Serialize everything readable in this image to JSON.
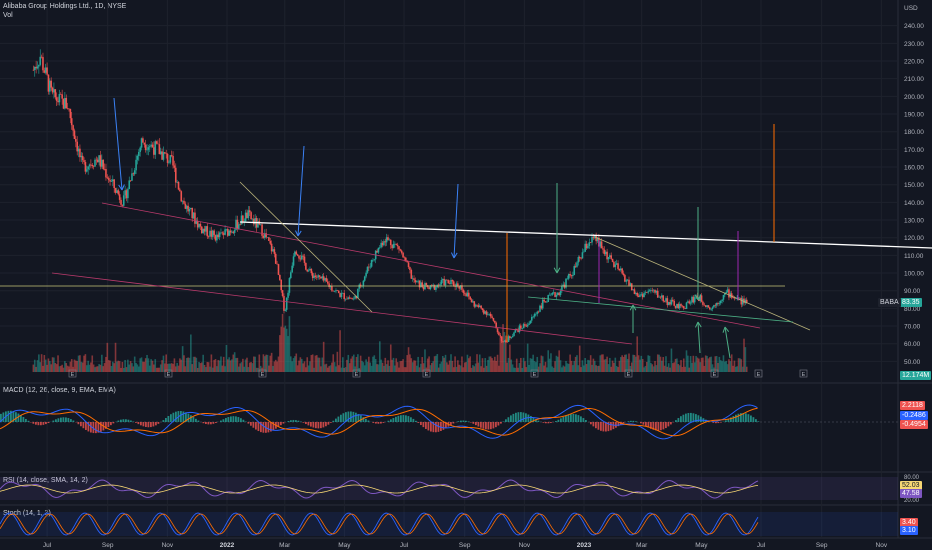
{
  "header": {
    "symbol_line": "Alibaba Group Holdings Ltd., 1D, NYSE",
    "vol_label": "Vol"
  },
  "indicators": {
    "macd": "MACD (12, 26, close, 9, EMA, EMA)",
    "rsi": "RSI (14, close, SMA, 14, 2)",
    "stoch": "Stoch (14, 1, 3)"
  },
  "colors": {
    "bg": "#131722",
    "up": "#26a69a",
    "down": "#ef5350",
    "macd": "#2962ff",
    "signal": "#ff6d00",
    "rsi": "#7e57c2",
    "stoch_k": "#2962ff",
    "stoch_d": "#ff6d00",
    "trend_white": "#ffffff"
  },
  "chart_data": {
    "type": "candlestick",
    "currency": "USD",
    "price_axis": {
      "ticks": [
        50,
        60,
        70,
        80,
        90,
        100,
        110,
        120,
        130,
        140,
        150,
        160,
        170,
        180,
        190,
        200,
        210,
        220,
        230,
        240
      ],
      "range": [
        44,
        250
      ]
    },
    "time_axis": [
      "Jul",
      "Sep",
      "Nov",
      "2022",
      "Mar",
      "May",
      "Jul",
      "Sep",
      "Nov",
      "2023",
      "Mar",
      "May",
      "Jul",
      "Sep",
      "Nov"
    ],
    "last_price": {
      "label": "BABA",
      "value": "83.35",
      "volume": "12.174M"
    },
    "close_path": [
      [
        "2021-07-01",
        215
      ],
      [
        "2021-07-08",
        223
      ],
      [
        "2021-07-20",
        200
      ],
      [
        "2021-08-05",
        195
      ],
      [
        "2021-08-20",
        160
      ],
      [
        "2021-09-05",
        165
      ],
      [
        "2021-09-20",
        150
      ],
      [
        "2021-10-01",
        140
      ],
      [
        "2021-10-20",
        175
      ],
      [
        "2021-11-05",
        170
      ],
      [
        "2021-11-20",
        162
      ],
      [
        "2021-12-01",
        140
      ],
      [
        "2021-12-20",
        125
      ],
      [
        "2022-01-05",
        120
      ],
      [
        "2022-01-20",
        125
      ],
      [
        "2022-02-05",
        133
      ],
      [
        "2022-02-20",
        124
      ],
      [
        "2022-03-05",
        110
      ],
      [
        "2022-03-15",
        78
      ],
      [
        "2022-03-25",
        115
      ],
      [
        "2022-04-10",
        100
      ],
      [
        "2022-04-25",
        95
      ],
      [
        "2022-05-10",
        88
      ],
      [
        "2022-05-25",
        85
      ],
      [
        "2022-06-10",
        105
      ],
      [
        "2022-06-25",
        120
      ],
      [
        "2022-07-10",
        114
      ],
      [
        "2022-07-25",
        95
      ],
      [
        "2022-08-10",
        91
      ],
      [
        "2022-08-25",
        95
      ],
      [
        "2022-09-10",
        93
      ],
      [
        "2022-09-25",
        82
      ],
      [
        "2022-10-10",
        77
      ],
      [
        "2022-10-25",
        60
      ],
      [
        "2022-11-05",
        67
      ],
      [
        "2022-11-20",
        72
      ],
      [
        "2022-12-05",
        84
      ],
      [
        "2022-12-20",
        89
      ],
      [
        "2023-01-05",
        102
      ],
      [
        "2023-01-20",
        118
      ],
      [
        "2023-01-27",
        119
      ],
      [
        "2023-02-10",
        108
      ],
      [
        "2023-02-25",
        98
      ],
      [
        "2023-03-10",
        87
      ],
      [
        "2023-03-25",
        90
      ],
      [
        "2023-04-10",
        84
      ],
      [
        "2023-04-25",
        80
      ],
      [
        "2023-05-10",
        87
      ],
      [
        "2023-05-25",
        80
      ],
      [
        "2023-06-10",
        89
      ],
      [
        "2023-06-25",
        84
      ],
      [
        "2023-07-01",
        83.35
      ]
    ],
    "panes": [
      {
        "name": "MACD",
        "values": {
          "macd": "2.2118",
          "signal": "-0.2486",
          "histogram": "-0.4954"
        }
      },
      {
        "name": "RSI",
        "levels": [
          80,
          20
        ],
        "values": {
          "rsi": "52.03",
          "rsi_ma": "47.58"
        }
      },
      {
        "name": "Stoch",
        "values": {
          "k": "3.40",
          "d": "3.10"
        }
      }
    ],
    "labels_e": [
      "E",
      "E",
      "E",
      "E",
      "E",
      "E",
      "E",
      "E",
      "E",
      "E"
    ]
  }
}
